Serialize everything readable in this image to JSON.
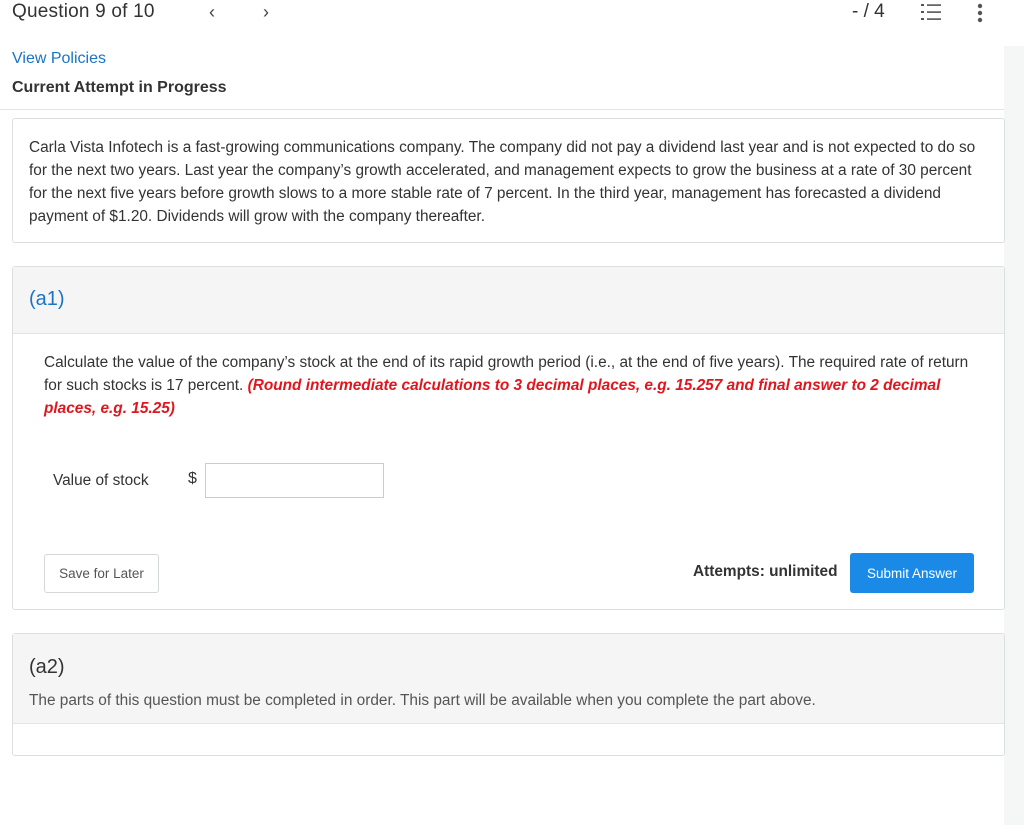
{
  "topbar": {
    "question_counter": "Question 9 of 10",
    "prev_icon": "chevron-left-icon",
    "next_icon": "chevron-right-icon",
    "score": "- / 4",
    "list_icon": "numbered-list-icon",
    "more_icon": "vertical-ellipsis-icon"
  },
  "header": {
    "view_policies": "View Policies",
    "attempt_status": "Current Attempt in Progress"
  },
  "problem": {
    "text": "Carla Vista Infotech is a fast-growing communications company. The company did not pay a dividend last year and is not expected to do so for the next two years. Last year the company’s growth accelerated, and management expects to grow the business at a rate of 30 percent for the next five years before growth slows to a more stable rate of 7 percent. In the third year, management has forecasted a dividend payment of $1.20. Dividends will grow with the company thereafter."
  },
  "part_a1": {
    "label": "(a1)",
    "question": "Calculate the value of the company’s stock at the end of its rapid growth period (i.e., at the end of five years). The required rate of return for such stocks is 17 percent. ",
    "instruction": "(Round intermediate calculations to 3 decimal places, e.g. 15.257 and final answer to 2 decimal places, e.g. 15.25)",
    "field_label": "Value of stock",
    "currency_symbol": "$",
    "input_value": "",
    "save_label": "Save for Later",
    "attempts": "Attempts: unlimited",
    "submit_label": "Submit Answer"
  },
  "part_a2": {
    "label": "(a2)",
    "note": "The parts of this question must be completed in order. This part will be available when you complete the part above."
  },
  "colors": {
    "link": "#1a73c7",
    "submit": "#1a8ae6",
    "instruction": "#e0161e"
  }
}
